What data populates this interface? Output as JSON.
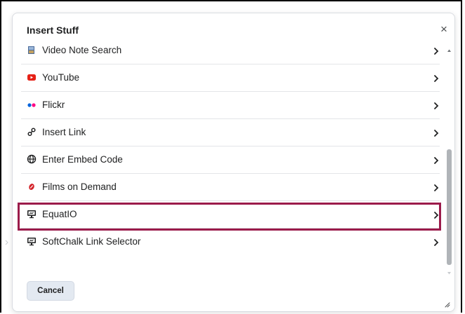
{
  "dialog": {
    "title": "Insert Stuff",
    "close_label": "×",
    "cancel_label": "Cancel"
  },
  "items": [
    {
      "label": "Video Note Search",
      "icon": "video-note-icon"
    },
    {
      "label": "YouTube",
      "icon": "youtube-icon"
    },
    {
      "label": "Flickr",
      "icon": "flickr-icon"
    },
    {
      "label": "Insert Link",
      "icon": "link-icon"
    },
    {
      "label": "Enter Embed Code",
      "icon": "globe-icon"
    },
    {
      "label": "Films on Demand",
      "icon": "films-on-demand-icon"
    },
    {
      "label": "EquatIO",
      "icon": "monitor-icon",
      "highlighted": true
    },
    {
      "label": "SoftChalk Link Selector",
      "icon": "monitor-icon"
    }
  ],
  "colors": {
    "highlight_outline": "#9b1b4b",
    "youtube_red": "#e62117",
    "flickr_blue": "#0063dc",
    "flickr_pink": "#ff0084",
    "films_red": "#d4242b"
  }
}
